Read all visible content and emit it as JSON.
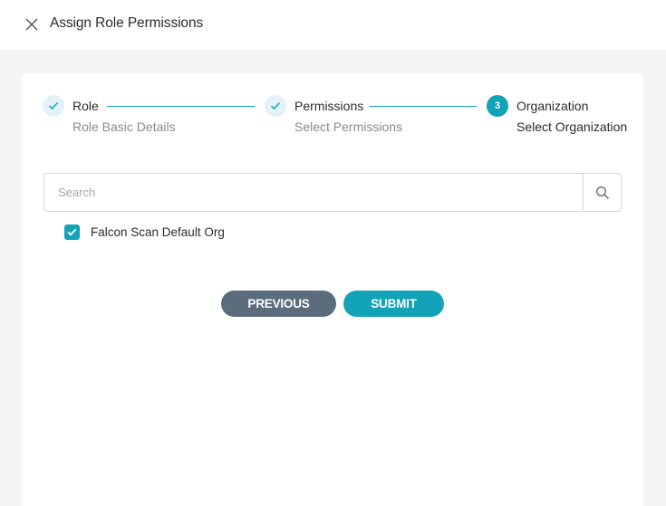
{
  "header": {
    "title": "Assign Role Permissions",
    "close_icon": "close-icon"
  },
  "stepper": {
    "steps": [
      {
        "title": "Role",
        "subtitle": "Role Basic Details",
        "state": "completed",
        "marker": "check-icon"
      },
      {
        "title": "Permissions",
        "subtitle": "Select Permissions",
        "state": "completed",
        "marker": "check-icon"
      },
      {
        "title": "Organization",
        "subtitle": "Select Organization",
        "state": "active",
        "marker": "3"
      }
    ]
  },
  "search": {
    "placeholder": "Search",
    "value": "",
    "icon": "search-icon"
  },
  "organizations": [
    {
      "label": "Falcon Scan Default Org",
      "checked": true
    }
  ],
  "actions": {
    "previous_label": "PREVIOUS",
    "submit_label": "SUBMIT"
  },
  "colors": {
    "accent": "#13a3b8",
    "secondary_button": "#5b6d7c",
    "completed_step_bg": "#e3f2fa",
    "page_bg": "#f4f4f4"
  }
}
